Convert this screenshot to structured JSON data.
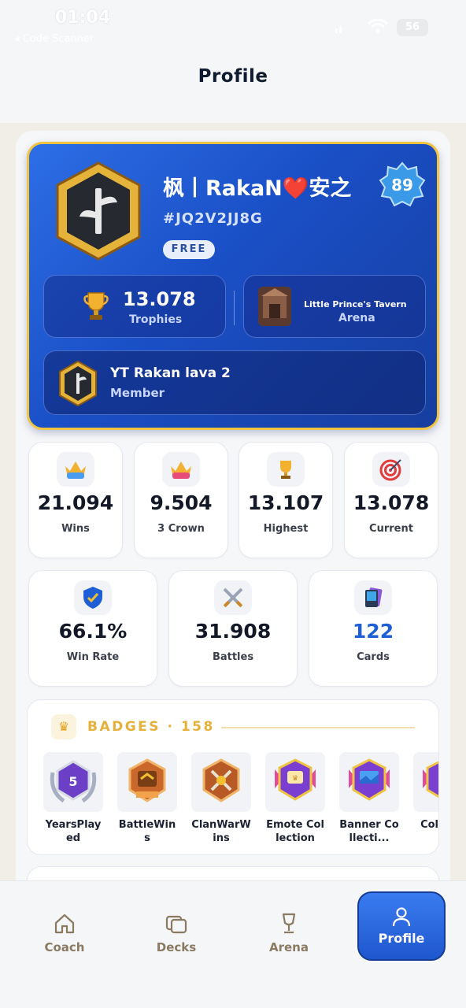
{
  "status_bar": {
    "time": "01:04",
    "back_app": "◂ Code Scanner",
    "battery": "56"
  },
  "header": {
    "title": "Profile"
  },
  "profile": {
    "name": "枫丨RakaN❤️安之",
    "tag": "#JQ2V2JJ8G",
    "account_type": "FREE",
    "level": "89",
    "trophies": {
      "value": "13.078",
      "label": "Trophies"
    },
    "arena": {
      "name": "Little Prince's Tavern",
      "label": "Arena"
    },
    "clan": {
      "name": "YT Rakan lava 2",
      "role": "Member"
    }
  },
  "stats_row1": [
    {
      "icon": "blue-crown-icon",
      "value": "21.094",
      "label": "Wins"
    },
    {
      "icon": "pink-crown-icon",
      "value": "9.504",
      "label": "3 Crown"
    },
    {
      "icon": "trophy-icon",
      "value": "13.107",
      "label": "Highest"
    },
    {
      "icon": "target-icon",
      "value": "13.078",
      "label": "Current"
    }
  ],
  "stats_row2": [
    {
      "icon": "shield-check-icon",
      "value": "66.1%",
      "label": "Win Rate"
    },
    {
      "icon": "crossed-swords-icon",
      "value": "31.908",
      "label": "Battles"
    },
    {
      "icon": "cards-icon",
      "value": "122",
      "label": "Cards",
      "accent": "#1f5fd6"
    }
  ],
  "badges": {
    "title": "BADGES · 158",
    "items": [
      {
        "label": "YearsPlayed",
        "icon": "years-played-badge-icon"
      },
      {
        "label": "BattleWins",
        "icon": "battle-wins-badge-icon"
      },
      {
        "label": "ClanWarWins",
        "icon": "clan-war-wins-badge-icon"
      },
      {
        "label": "Emote Collection",
        "icon": "emote-collection-badge-icon"
      },
      {
        "label": "Banner Collecti...",
        "icon": "banner-collection-badge-icon"
      },
      {
        "label": "Colle Le",
        "icon": "collection-level-badge-icon"
      }
    ]
  },
  "bottom_nav": [
    {
      "label": "Coach",
      "icon": "home-icon"
    },
    {
      "label": "Decks",
      "icon": "decks-icon"
    },
    {
      "label": "Arena",
      "icon": "arena-goblet-icon"
    },
    {
      "label": "Profile",
      "icon": "person-icon",
      "active": true
    }
  ],
  "colors": {
    "primary_blue": "#1f57cf",
    "gold": "#f0c441",
    "badge_title": "#e6b13a",
    "nav_inactive": "#8a7a62"
  }
}
